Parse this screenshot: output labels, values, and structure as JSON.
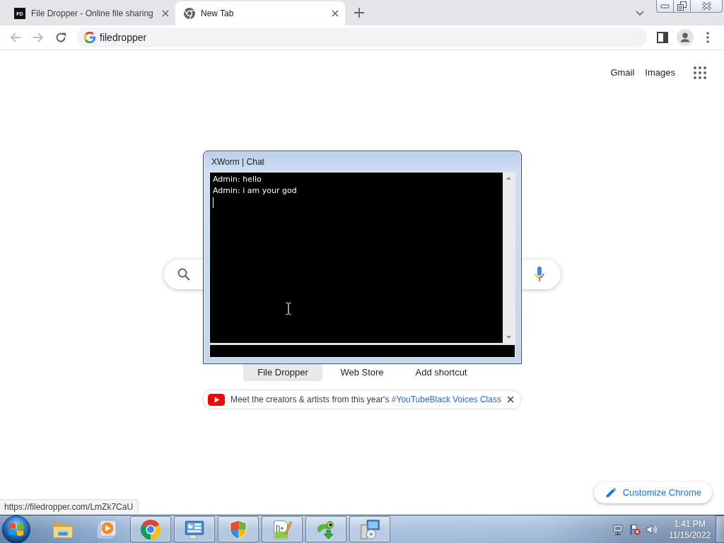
{
  "browser": {
    "tabs": [
      {
        "kind": "site",
        "favicon": "FD",
        "title": "File Dropper - Online file sharing",
        "selected": false
      },
      {
        "kind": "newtab",
        "title": "New Tab",
        "selected": true
      }
    ],
    "toolbar": {
      "back": {
        "disabled": true
      },
      "forward": {
        "disabled": true
      },
      "omnibox": {
        "value": "filedropper"
      }
    }
  },
  "new_tab_page": {
    "header_links": [
      "Gmail",
      "Images"
    ],
    "shortcuts": [
      {
        "label": "File Dropper",
        "highlighted": true
      },
      {
        "label": "Web Store",
        "highlighted": false
      },
      {
        "label": "Add shortcut",
        "highlighted": false
      }
    ],
    "promo": {
      "text": "Meet the creators & artists from this year's",
      "link": "#YouTubeBlack Voices Class"
    },
    "customize_button": "Customize Chrome"
  },
  "status_bubble": "https://filedropper.com/LmZk7CaU",
  "chat_window": {
    "title": "XWorm | Chat",
    "messages": [
      "Admin: hello",
      "Admin: i am your god"
    ]
  },
  "taskbar": {
    "items": [
      {
        "kind": "explorer",
        "running": false
      },
      {
        "kind": "media-player",
        "running": false
      },
      {
        "kind": "chrome",
        "running": true
      },
      {
        "kind": "control-panel",
        "running": true
      },
      {
        "kind": "security",
        "running": true
      },
      {
        "kind": "notepad",
        "running": true
      },
      {
        "kind": "installer",
        "running": true
      },
      {
        "kind": "setup",
        "running": true
      }
    ],
    "clock": {
      "time": "1:41 PM",
      "date": "11/15/2022"
    }
  }
}
